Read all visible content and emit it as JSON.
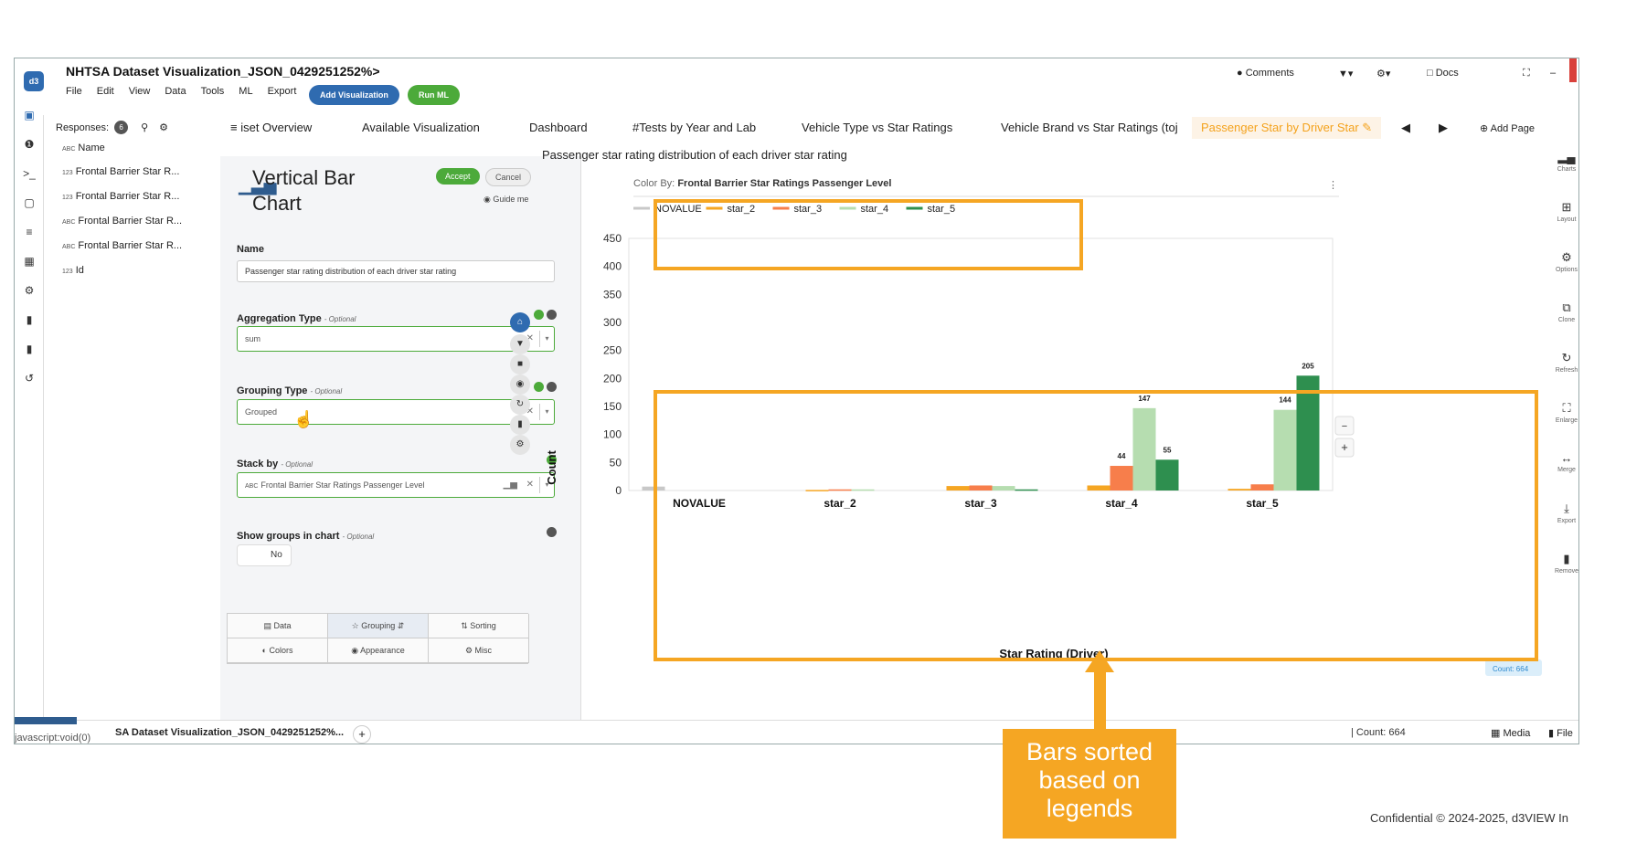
{
  "app": {
    "logo_text": "d3",
    "title": "NHTSA Dataset Visualization_JSON_0429251252%>",
    "menu": [
      "File",
      "Edit",
      "View",
      "Data",
      "Tools",
      "ML",
      "Export"
    ],
    "add_visualization": "Add Visualization",
    "run_ml": "Run ML",
    "comments": "Comments",
    "docs": "Docs"
  },
  "responses": {
    "label": "Responses:",
    "count": "6",
    "fields": [
      {
        "type": "ABC",
        "name": "Name"
      },
      {
        "type": "123",
        "name": "Frontal Barrier Star R..."
      },
      {
        "type": "123",
        "name": "Frontal Barrier Star R..."
      },
      {
        "type": "ABC",
        "name": "Frontal Barrier Star R..."
      },
      {
        "type": "ABC",
        "name": "Frontal Barrier Star R..."
      },
      {
        "type": "123",
        "name": "Id"
      }
    ]
  },
  "tabs": [
    "≡  iset Overview",
    "Available Visualization",
    "Dashboard",
    "#Tests by Year and Lab",
    "Vehicle Type vs Star Ratings",
    "Vehicle Brand vs Star Ratings (toj",
    "Passenger Star by Driver Star"
  ],
  "add_page": "Add Page",
  "settings": {
    "chart_type": "Vertical Bar Chart",
    "accept": "Accept",
    "cancel": "Cancel",
    "guide_me": "Guide me",
    "name_label": "Name",
    "name_value": "Passenger star rating distribution of each driver star rating",
    "aggregation_label": "Aggregation Type",
    "aggregation_value": "sum",
    "grouping_label": "Grouping Type",
    "grouping_value": "Grouped",
    "stack_label": "Stack by",
    "stack_type": "ABC",
    "stack_value": "Frontal Barrier Star Ratings Passenger Level",
    "show_groups_label": "Show groups in chart",
    "show_groups_value": "No",
    "optional": "- Optional",
    "bottom_tabs": [
      "Data",
      "Grouping",
      "Sorting",
      "Colors",
      "Appearance",
      "Misc"
    ]
  },
  "chart_data": {
    "type": "bar",
    "title": "Passenger star rating distribution of each driver star rating",
    "color_by_label": "Color By:",
    "color_by": "Frontal Barrier Star Ratings Passenger Level",
    "xlabel": "Star Rating (Driver)",
    "ylabel": "Count",
    "ylim": [
      0,
      450
    ],
    "yticks": [
      0,
      50,
      100,
      150,
      200,
      250,
      300,
      350,
      400,
      450
    ],
    "categories": [
      "NOVALUE",
      "star_2",
      "star_3",
      "star_4",
      "star_5"
    ],
    "series": [
      {
        "name": "NOVALUE",
        "color": "#c8c8c8",
        "values": [
          7,
          0,
          0,
          0,
          0
        ]
      },
      {
        "name": "star_2",
        "color": "#f5a623",
        "values": [
          0,
          1,
          8,
          9,
          3
        ]
      },
      {
        "name": "star_3",
        "color": "#f77e4b",
        "values": [
          0,
          2,
          9,
          44,
          11
        ]
      },
      {
        "name": "star_4",
        "color": "#b6ddb0",
        "values": [
          0,
          2,
          8,
          147,
          144
        ]
      },
      {
        "name": "star_5",
        "color": "#2e8f4f",
        "values": [
          0,
          0,
          2,
          55,
          205
        ]
      }
    ],
    "data_labels": {
      "star_4": [
        44,
        147,
        55
      ],
      "star_5": [
        144,
        205
      ]
    },
    "grid": false,
    "legend": "top-left",
    "count_badge": "Count: 664"
  },
  "footer": {
    "status": "javascript:void(0)",
    "tab": "SA Dataset Visualization_JSON_0429251252%...",
    "count": "Count: 664",
    "media": "Media",
    "files": "File"
  },
  "annotation": {
    "callout": "Bars sorted based on legends",
    "confidential": "Confidential © 2024-2025, d3VIEW In"
  },
  "colors": {
    "accent": "#f5a623",
    "primary": "#2f6bb0",
    "success": "#4caa3a"
  }
}
